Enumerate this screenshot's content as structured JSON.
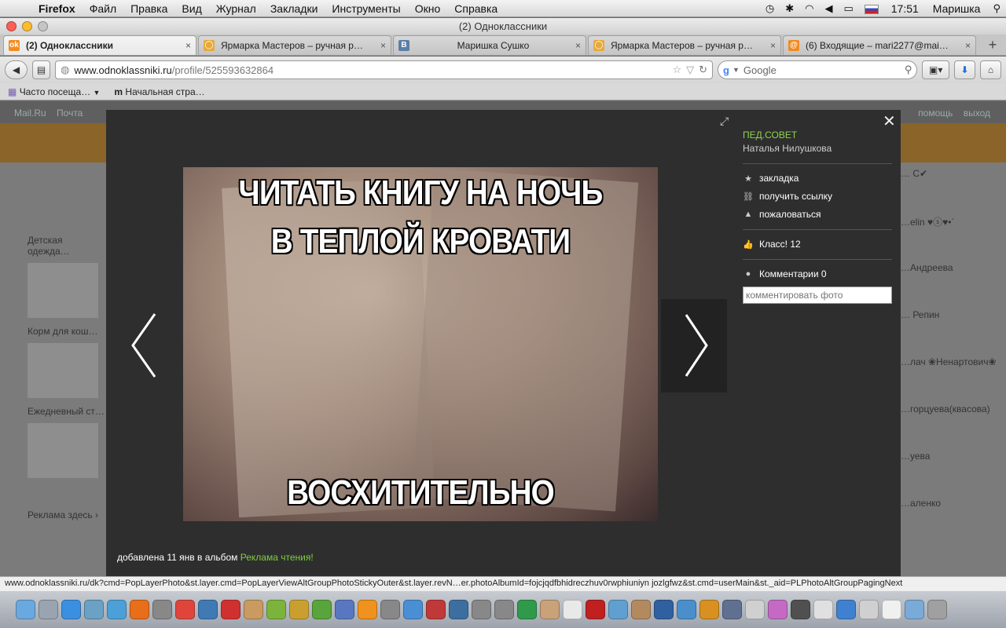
{
  "menubar": {
    "app": "Firefox",
    "items": [
      "Файл",
      "Правка",
      "Вид",
      "Журнал",
      "Закладки",
      "Инструменты",
      "Окно",
      "Справка"
    ],
    "time": "17:51",
    "user": "Маришка"
  },
  "window": {
    "title": "(2) Одноклассники"
  },
  "tabs": [
    {
      "title": "(2) Одноклассники",
      "icon": "odnoklassniki-icon",
      "color": "#f48b1f"
    },
    {
      "title": "Ярмарка Мастеров – ручная р…",
      "icon": "livemaster-icon",
      "color": "#e8a93c"
    },
    {
      "title": "Маришка Сушко",
      "icon": "vk-icon",
      "color": "#5b7fa6"
    },
    {
      "title": "Ярмарка Мастеров – ручная р…",
      "icon": "livemaster-icon",
      "color": "#e8a93c"
    },
    {
      "title": "(6) Входящие – mari2277@mai…",
      "icon": "mailru-icon",
      "color": "#f28a1e"
    }
  ],
  "nav": {
    "url_host": "www.odnoklassniki.ru",
    "url_path": "/profile/525593632864",
    "search_placeholder": "Google"
  },
  "bookmarks": [
    "Часто посеща…",
    "Начальная стра…"
  ],
  "background_page": {
    "top_left": [
      "Mail.Ru",
      "Почта"
    ],
    "top_right": [
      "помощь",
      "выход"
    ],
    "left_items": [
      "Детская одежда…",
      "Корм для кош…",
      "Ежедневный ст…",
      "Реклама здесь ›"
    ],
    "right_names": [
      "… С✔",
      "…elin ♥ⓢ♥•´",
      "…Андреева",
      "… Репин",
      "…лач ❀Ненартович❀",
      "…горцуева(квасова)",
      "…уева",
      "…аленко"
    ]
  },
  "photo_layer": {
    "meme_top_line1": "ЧИТАТЬ КНИГУ НА НОЧЬ",
    "meme_top_line2": "В ТЕПЛОЙ КРОВАТИ",
    "meme_bottom": "ВОСХИТИТЕЛЬНО",
    "group": "ПЕД.СОВЕТ",
    "author": "Наталья Нилушкова",
    "actions": {
      "bookmark": "закладка",
      "get_link": "получить ссылку",
      "report": "пожаловаться"
    },
    "class_label": "Класс! 12",
    "comments_label": "Комментарии 0",
    "comment_placeholder": "комментировать фото",
    "added_prefix": "добавлена 11 янв в альбом",
    "album": "Реклама чтения!"
  },
  "statusbar": {
    "text": "www.odnoklassniki.ru/dk?cmd=PopLayerPhoto&st.layer.cmd=PopLayerViewAltGroupPhotoStickyOuter&st.layer.revN…er.photoAlbumId=fojcjqdfbhidreczhuv0rwphiuniyn jozlgfwz&st.cmd=userMain&st._aid=PLPhotoAltGroupPagingNext"
  },
  "dock": {
    "icons": [
      "finder-icon",
      "launchpad-icon",
      "appstore-icon",
      "preview-icon",
      "safari-icon",
      "firefox-icon",
      "help-icon",
      "chrome-icon",
      "google-earth-icon",
      "pen-icon",
      "photo-icon",
      "game-icon",
      "game-icon",
      "game-icon",
      "lens-icon",
      "vlc-icon",
      "help-icon",
      "itunes-icon",
      "photobooth-icon",
      "iphoto-icon",
      "help-icon",
      "help-icon",
      "facetime-icon",
      "addressbook-icon",
      "calendar-icon",
      "acrobat-icon",
      "mail-icon",
      "fingerprint-icon",
      "stylus-icon",
      "chart-icon",
      "presentation-icon",
      "screenshot-icon",
      "clock-icon",
      "paint-icon",
      "board-icon",
      "printer-icon",
      "hp-icon",
      "printer-icon",
      "document-icon",
      "folder-icon",
      "trash-icon"
    ],
    "colors": [
      "#6aa8e0",
      "#9aa4b0",
      "#3b8fe0",
      "#6aa1c5",
      "#4ca0d8",
      "#e86e1a",
      "#888888",
      "#e0453c",
      "#3f7ab5",
      "#d03030",
      "#c99b60",
      "#7cb33a",
      "#c9a030",
      "#5aa43c",
      "#5877c0",
      "#f0921e",
      "#888888",
      "#4a8fd6",
      "#c03838",
      "#3c6fa0",
      "#888888",
      "#888888",
      "#2f9a4a",
      "#c9a27a",
      "#e9e9e9",
      "#c02020",
      "#5fa0d0",
      "#b38a60",
      "#3060a0",
      "#4a8fcb",
      "#d89020",
      "#607090",
      "#d0d0d0",
      "#c46ac4",
      "#505050",
      "#e0e0e0",
      "#4080d0",
      "#d0d0d0",
      "#f0f0f0",
      "#7aaad8",
      "#a0a0a0"
    ]
  }
}
